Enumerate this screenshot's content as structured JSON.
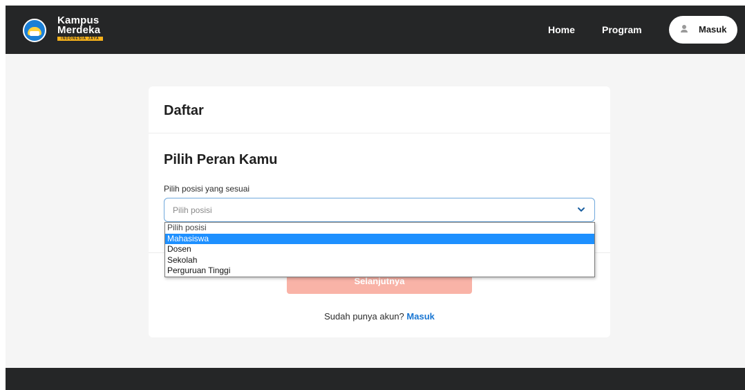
{
  "navbar": {
    "logo_line1": "Kampus",
    "logo_line2": "Merdeka",
    "logo_tagline": "INDONESIA JAYA",
    "links": [
      "Home",
      "Program"
    ],
    "login_label": "Masuk",
    "background": "#252627"
  },
  "card": {
    "title": "Daftar",
    "section_title": "Pilih Peran Kamu",
    "field_label": "Pilih posisi yang sesuai",
    "select_placeholder": "Pilih posisi",
    "next_button": "Selanjutnya",
    "footer_prefix": "Sudah punya akun?",
    "footer_link": "Masuk"
  },
  "dropdown": {
    "options": [
      "Pilih posisi",
      "Mahasiswa",
      "Dosen",
      "Sekolah",
      "Perguruan Tinggi"
    ],
    "highlighted": "Mahasiswa"
  },
  "colors": {
    "accent": "#1976d2",
    "highlight": "#1e90ff",
    "button_disabled": "#f9b3a7"
  },
  "icons": {
    "logo": "tut-wuri-handayani-emblem",
    "login": "user-icon",
    "select": "chevron-down-icon"
  }
}
